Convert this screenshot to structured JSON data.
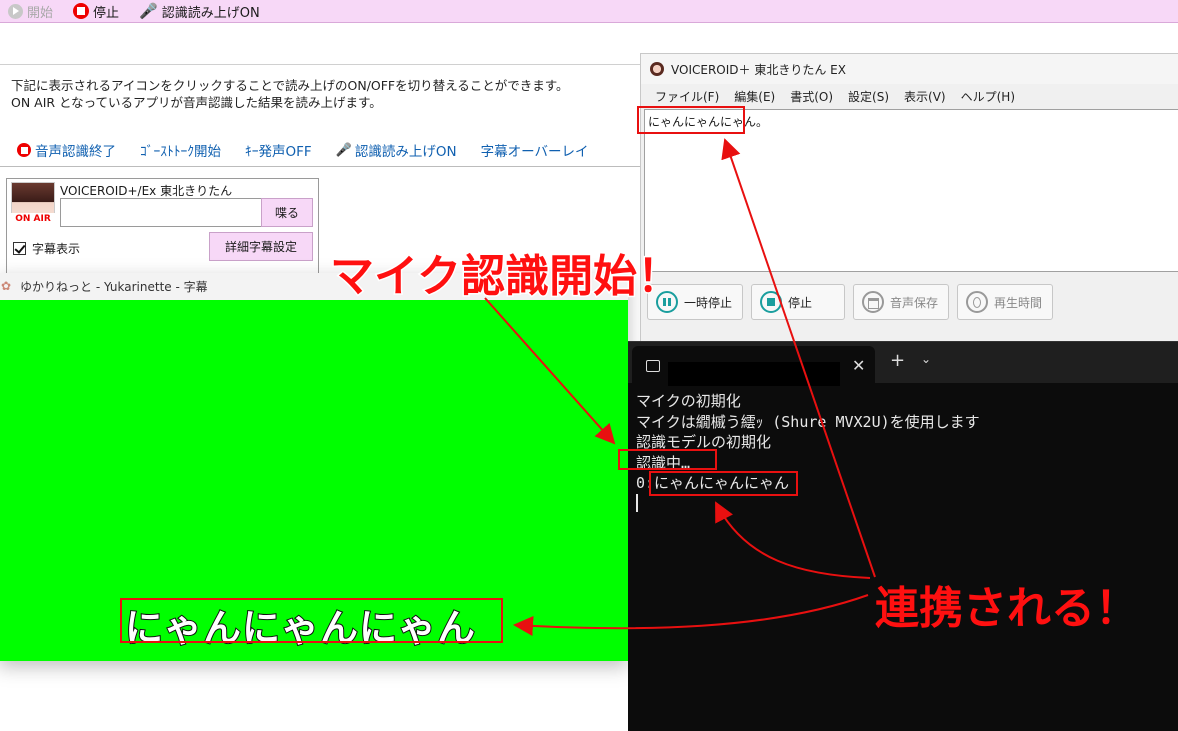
{
  "toolbar": {
    "start_label": "開始",
    "stop_label": "停止",
    "read_on_label": "認識読み上げON"
  },
  "main": {
    "desc_line1": "下記に表示されるアイコンをクリックすることで読み上げのON/OFFを切り替えることができます。",
    "desc_line2": "ON AIR となっているアプリが音声認識した結果を読み上げます。",
    "actions": {
      "end_recognition": "音声認識終了",
      "ghost_talk": "ｺﾞｰｽﾄﾄｰｸ開始",
      "key_voice": "ｷｰ発声OFF",
      "read_on": "認識読み上げON",
      "overlay": "字幕オーバーレイ"
    },
    "voice_panel": {
      "name": "VOICEROID+/Ex 東北きりたん",
      "on_air": "ON AIR",
      "speak_label": "喋る",
      "subtitle_check": "字幕表示",
      "detail_label": "詳細字幕設定"
    }
  },
  "yukarinette": {
    "title": "ゆかりねっと - Yukarinette - 字幕",
    "subtitle": "にゃんにゃんにゃん"
  },
  "voiceroid": {
    "title": "VOICEROID＋ 東北きりたん EX",
    "menu": [
      "ファイル(F)",
      "編集(E)",
      "書式(O)",
      "設定(S)",
      "表示(V)",
      "ヘルプ(H)"
    ],
    "text": "にゃんにゃんにゃん。",
    "buttons": {
      "pause": "一時停止",
      "stop": "停止",
      "save": "音声保存",
      "playtime": "再生時間"
    }
  },
  "terminal": {
    "close": "✕",
    "plus": "+",
    "lines": [
      "マイクの初期化",
      "マイクは繝槭う繧ｯ (Shure MVX2U)を使用します",
      "認識モデルの初期化",
      "認識中…",
      "0:にゃんにゃんにゃん"
    ]
  },
  "annotations": {
    "start": "マイク認識開始！",
    "linked": "連携される！",
    "color": "#ff1010"
  }
}
